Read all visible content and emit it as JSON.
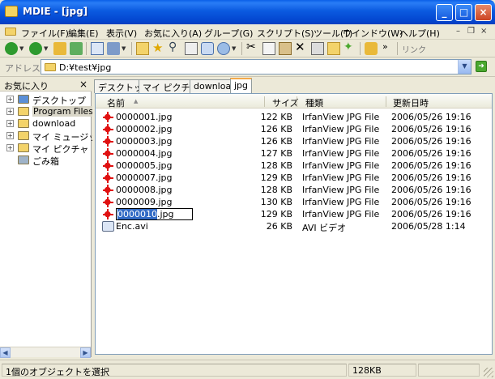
{
  "window": {
    "title": "MDIE - [jpg]"
  },
  "menu": [
    {
      "label": "ファイル(F)"
    },
    {
      "label": "編集(E)"
    },
    {
      "label": "表示(V)"
    },
    {
      "label": "お気に入り(A)"
    },
    {
      "label": "グループ(G)"
    },
    {
      "label": "スクリプト(S)"
    },
    {
      "label": "ツール(T)"
    },
    {
      "label": "ウインドウ(W)"
    },
    {
      "label": "ヘルプ(H)"
    }
  ],
  "toolbar": {
    "link_label": "リンク",
    "more_chevron": "»"
  },
  "address": {
    "label": "アドレス",
    "path": "D:¥test¥jpg"
  },
  "left_pane": {
    "title": "お気に入り",
    "close": "×",
    "tree": [
      {
        "label": "デスクトップ",
        "expander": "+",
        "icon": "desktop-icon",
        "color": "#5b8fd6"
      },
      {
        "label": "Program Files",
        "expander": "+",
        "icon": "folder-icon",
        "color": "#f3d36a",
        "selected": true
      },
      {
        "label": "download",
        "expander": "+",
        "icon": "folder-icon",
        "color": "#f3d36a"
      },
      {
        "label": "マイ ミュージック",
        "expander": "+",
        "icon": "music-folder-icon",
        "color": "#f3d36a"
      },
      {
        "label": "マイ ピクチャ",
        "expander": "+",
        "icon": "picture-folder-icon",
        "color": "#f3d36a"
      },
      {
        "label": "ごみ箱",
        "expander": "",
        "icon": "recycle-bin-icon",
        "color": "#9fb3c8"
      }
    ]
  },
  "tabs": [
    {
      "label": "デスクトップ"
    },
    {
      "label": "マイ ピクチャ"
    },
    {
      "label": "download"
    },
    {
      "label": "jpg",
      "active": true
    }
  ],
  "columns": {
    "name": "名前",
    "size": "サイズ",
    "type": "種類",
    "date": "更新日時"
  },
  "files": [
    {
      "name": "0000001.jpg",
      "size": "122 KB",
      "type": "IrfanView JPG File",
      "date": "2006/05/26 19:16",
      "icon": "jpg"
    },
    {
      "name": "0000002.jpg",
      "size": "126 KB",
      "type": "IrfanView JPG File",
      "date": "2006/05/26 19:16",
      "icon": "jpg"
    },
    {
      "name": "0000003.jpg",
      "size": "126 KB",
      "type": "IrfanView JPG File",
      "date": "2006/05/26 19:16",
      "icon": "jpg"
    },
    {
      "name": "0000004.jpg",
      "size": "127 KB",
      "type": "IrfanView JPG File",
      "date": "2006/05/26 19:16",
      "icon": "jpg"
    },
    {
      "name": "0000005.jpg",
      "size": "128 KB",
      "type": "IrfanView JPG File",
      "date": "2006/05/26 19:16",
      "icon": "jpg"
    },
    {
      "name": "0000007.jpg",
      "size": "129 KB",
      "type": "IrfanView JPG File",
      "date": "2006/05/26 19:16",
      "icon": "jpg"
    },
    {
      "name": "0000008.jpg",
      "size": "128 KB",
      "type": "IrfanView JPG File",
      "date": "2006/05/26 19:16",
      "icon": "jpg"
    },
    {
      "name": "0000009.jpg",
      "size": "130 KB",
      "type": "IrfanView JPG File",
      "date": "2006/05/26 19:16",
      "icon": "jpg"
    },
    {
      "name_highlight": "0000010",
      "name_rest": ".jpg",
      "size": "129 KB",
      "type": "IrfanView JPG File",
      "date": "2006/05/26 19:16",
      "icon": "jpg",
      "editing": true
    },
    {
      "name": "Enc.avi",
      "size": "26 KB",
      "type": "AVI ビデオ",
      "date": "2006/05/28 1:14",
      "icon": "avi"
    }
  ],
  "status": {
    "message": "1個のオブジェクトを選択",
    "size": "128KB"
  }
}
